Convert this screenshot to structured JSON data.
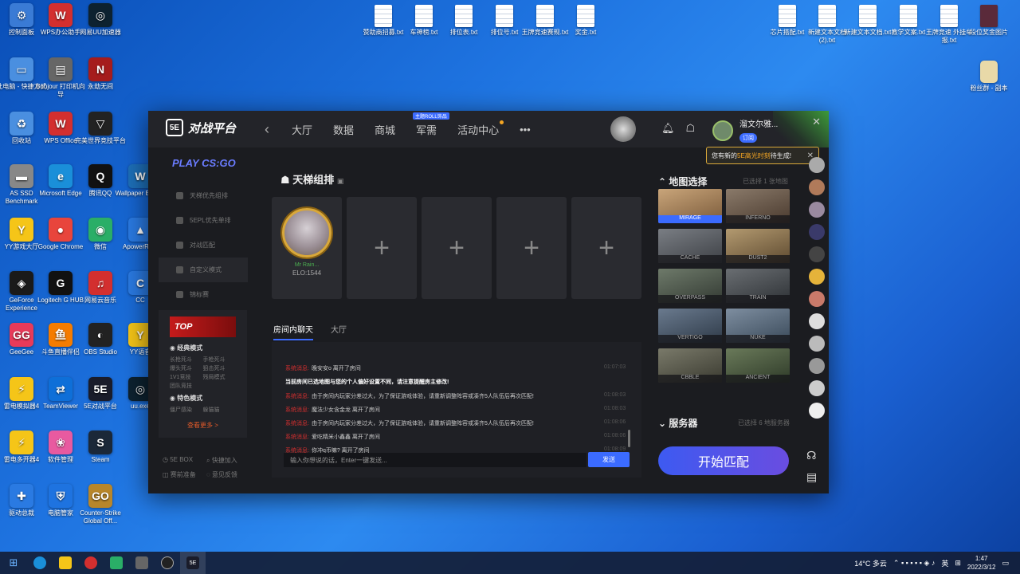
{
  "desktop_left": [
    {
      "label": "控制面板",
      "icon": "control-panel-icon",
      "color": "#3a7bd5",
      "glyph": "⚙"
    },
    {
      "label": "WPS办公助手",
      "icon": "wps-icon",
      "color": "#d32f2f",
      "glyph": "W"
    },
    {
      "label": "网易UU加速器",
      "icon": "uu-accelerator-icon",
      "color": "#0d2230",
      "glyph": "◎"
    },
    {
      "label": "此电脑 - 快捷方式",
      "icon": "this-pc-icon",
      "color": "#4a8fe0",
      "glyph": "▭"
    },
    {
      "label": "Bonjour 打印机向导",
      "icon": "printer-icon",
      "color": "#666",
      "glyph": "▤"
    },
    {
      "label": "永劫无间",
      "icon": "naraka-icon",
      "color": "#a51c1c",
      "glyph": "N"
    },
    {
      "label": "回收站",
      "icon": "recycle-bin-icon",
      "color": "#4a8fe0",
      "glyph": "♻"
    },
    {
      "label": "WPS Office",
      "icon": "wps-office-icon",
      "color": "#d32f2f",
      "glyph": "W"
    },
    {
      "label": "完美世界竞技平台",
      "icon": "perfect-world-icon",
      "color": "#222",
      "glyph": "▽"
    },
    {
      "label": "AS SSD Benchmark",
      "icon": "ssd-icon",
      "color": "#888",
      "glyph": "▬"
    },
    {
      "label": "Microsoft Edge",
      "icon": "edge-icon",
      "color": "#1a8fd9",
      "glyph": "e"
    },
    {
      "label": "腾讯QQ",
      "icon": "qq-icon",
      "color": "#111",
      "glyph": "Q"
    },
    {
      "label": "Wallpaper Engine",
      "icon": "wallpaper-engine-icon",
      "color": "#1d6fb8",
      "glyph": "W"
    },
    {
      "label": "YY游戏大厅",
      "icon": "yy-icon",
      "color": "#f5c518",
      "glyph": "Y"
    },
    {
      "label": "Google Chrome",
      "icon": "chrome-icon",
      "color": "#e8453c",
      "glyph": "●"
    },
    {
      "label": "微信",
      "icon": "wechat-icon",
      "color": "#2aae67",
      "glyph": "◉"
    },
    {
      "label": "ApowerREC",
      "icon": "apower-icon",
      "color": "#2a7ae2",
      "glyph": "▲"
    },
    {
      "label": "GeForce Experience",
      "icon": "geforce-icon",
      "color": "#1a1a1a",
      "glyph": "◈"
    },
    {
      "label": "Logitech G HUB",
      "icon": "ghub-icon",
      "color": "#111",
      "glyph": "G"
    },
    {
      "label": "网易云音乐",
      "icon": "netease-music-icon",
      "color": "#d32f2f",
      "glyph": "♫"
    },
    {
      "label": "CC",
      "icon": "cc-icon",
      "color": "#2a7ae2",
      "glyph": "C"
    },
    {
      "label": "GeeGee",
      "icon": "geegee-icon",
      "color": "#e83a5a",
      "glyph": "GG"
    },
    {
      "label": "斗鱼直播伴侣",
      "icon": "douyu-icon",
      "color": "#f57c00",
      "glyph": "鱼"
    },
    {
      "label": "OBS Studio",
      "icon": "obs-icon",
      "color": "#222",
      "glyph": "◐"
    },
    {
      "label": "YY语音",
      "icon": "yy-voice-icon",
      "color": "#f5c518",
      "glyph": "Y"
    },
    {
      "label": "雷电模拟器4",
      "icon": "ldplayer-icon",
      "color": "#f5c518",
      "glyph": "⚡"
    },
    {
      "label": "TeamViewer",
      "icon": "teamviewer-icon",
      "color": "#0e6fd8",
      "glyph": "⇄"
    },
    {
      "label": "5E对战平台",
      "icon": "5e-icon",
      "color": "#1a1c2a",
      "glyph": "5E"
    },
    {
      "label": "uu.exe",
      "icon": "uu-exe-icon",
      "color": "#0d2230",
      "glyph": "◎"
    },
    {
      "label": "雷电多开器4",
      "icon": "ld-multi-icon",
      "color": "#f5c518",
      "glyph": "⚡"
    },
    {
      "label": "软件管理",
      "icon": "software-manager-icon",
      "color": "#e85aa0",
      "glyph": "❀"
    },
    {
      "label": "Steam",
      "icon": "steam-icon",
      "color": "#1b2838",
      "glyph": "S"
    },
    {
      "label": "驱动总裁",
      "icon": "driver-icon",
      "color": "#2a7ae2",
      "glyph": "✚"
    },
    {
      "label": "电脑管家",
      "icon": "pc-manager-icon",
      "color": "#1e73e0",
      "glyph": "⛨"
    },
    {
      "label": "Counter-Strike Global Off...",
      "icon": "csgo-icon",
      "color": "#b8862a",
      "glyph": "GO"
    }
  ],
  "desktop_top_files": [
    "赞助商招募.txt",
    "车神榜.txt",
    "排位表.txt",
    "排位号.txt",
    "王牌竞速赛规.txt",
    "奖金.txt"
  ],
  "desktop_right_files": [
    "芯片搭配.txt",
    "新建文本文档 (2).txt",
    "新建文本文档.txt",
    "教学文案.txt",
    "王牌竞速 外挂举报.txt",
    "段位奖金图片"
  ],
  "desktop_right_extra": "粉丝群 - 副本",
  "app": {
    "logo_text": "对战平台",
    "logo_badge": "5E",
    "nav": {
      "back": "‹",
      "items": [
        "大厅",
        "数据",
        "商城",
        "军需",
        "活动中心"
      ],
      "junxu_tag": "主题ROLL饰品",
      "more": "•••"
    },
    "user": {
      "name": "溜文尔雅...",
      "sub_badge": "订阅"
    },
    "close": "✕",
    "notice": {
      "pre": "您有新的 ",
      "highlight": "5E高光时刻",
      "post": " 待生成!",
      "close": "✕"
    },
    "sidebar": {
      "play": "PLAY CS:GO",
      "items": [
        "天梯优先组排",
        "5EPL优先单排",
        "对战匹配",
        "自定义模式",
        "锦标赛"
      ],
      "top_banner": "TOP",
      "classic_title": "经典模式",
      "classic_modes": [
        "长枪死斗",
        "手枪死斗",
        "爆头死斗",
        "狙击死斗",
        "1V1竞技",
        "残局模式",
        "团队竞技",
        ""
      ],
      "special_title": "特色模式",
      "special_modes": [
        "僵尸感染",
        "躲猫猫"
      ],
      "more": "查看更多 >",
      "footer": [
        "5E BOX",
        "快捷加入",
        "赛前准备",
        "意见反馈"
      ]
    },
    "lobby": {
      "title": "天梯组排",
      "player_name": "Mr Rain...",
      "player_elo": "ELO:1544",
      "empty_slot": "+"
    },
    "chat": {
      "tab_room": "房间内聊天",
      "tab_hall": "大厅",
      "messages": [
        {
          "sys": "系统消息:",
          "text": "晚安安o 离开了房间",
          "time": "01:07:03"
        },
        {
          "sys": "",
          "text": "当前房间已选地图与您的个人偏好设置不同，请注意提醒房主修改!",
          "time": "",
          "bold": true
        },
        {
          "sys": "系统消息:",
          "text": "由于房间内玩家分差过大，为了保证游戏体验，请重新调整阵容或凑齐5人队伍后再次匹配!",
          "time": "01:08:03"
        },
        {
          "sys": "系统消息:",
          "text": "魔法少女含金龙 离开了房间",
          "time": "01:08:03"
        },
        {
          "sys": "系统消息:",
          "text": "由于房间内玩家分差过大，为了保证游戏体验，请重新调整阵容或凑齐5人队伍后再次匹配!",
          "time": "01:08:06"
        },
        {
          "sys": "系统消息:",
          "text": "爱吃精米小鑫鑫 离开了房间",
          "time": "01:08:06"
        },
        {
          "sys": "系统消息:",
          "text": "你冲q币嘛? 离开了房间",
          "time": "01:08:09"
        }
      ],
      "input_placeholder": "输入你想说的话，Enter一键发送...",
      "send": "发送"
    },
    "maps": {
      "title": "地图选择",
      "selected_info": "已选择 1 张地图",
      "items": [
        {
          "name": "MIRAGE",
          "selected": true,
          "c1": "#c9a57a",
          "c2": "#7a5a3a"
        },
        {
          "name": "INFERNO",
          "selected": false,
          "c1": "#8a7a6a",
          "c2": "#4a3a2e"
        },
        {
          "name": "CACHE",
          "selected": false,
          "c1": "#7a7e84",
          "c2": "#3d4045"
        },
        {
          "name": "DUST2",
          "selected": false,
          "c1": "#b39a70",
          "c2": "#5e4a30"
        },
        {
          "name": "OVERPASS",
          "selected": false,
          "c1": "#6e7a6a",
          "c2": "#333a33"
        },
        {
          "name": "TRAIN",
          "selected": false,
          "c1": "#6a6e72",
          "c2": "#2e3236"
        },
        {
          "name": "VERTIGO",
          "selected": false,
          "c1": "#6a7a8e",
          "c2": "#2e3a48"
        },
        {
          "name": "NUKE",
          "selected": false,
          "c1": "#7e8ea0",
          "c2": "#3a4a5a"
        },
        {
          "name": "CBBLE",
          "selected": false,
          "c1": "#7a7a6a",
          "c2": "#3a3a30"
        },
        {
          "name": "ANCIENT",
          "selected": false,
          "c1": "#6a7a5a",
          "c2": "#2e3a28"
        }
      ]
    },
    "server": {
      "title": "服务器",
      "selected_info": "已选择 6 地服务器"
    },
    "start_button": "开始匹配"
  },
  "taskbar": {
    "weather": "14°C 多云",
    "lang": "英",
    "time": "1:47",
    "date": "2022/3/12"
  }
}
